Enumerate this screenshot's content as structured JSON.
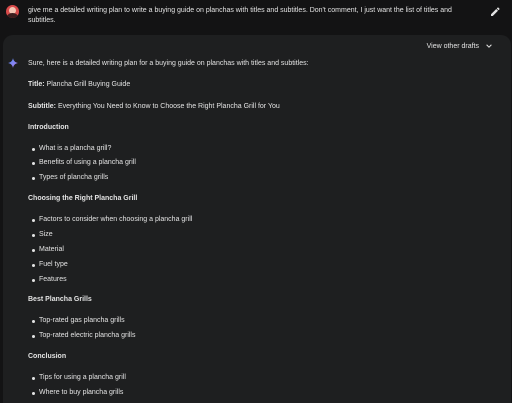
{
  "prompt": {
    "text": "give me a detailed writing plan to write a buying guide on planchas with titles and subtitles. Don't comment, I just want the list of titles and subtitles."
  },
  "response": {
    "drafts_label": "View other drafts",
    "intro": "Sure, here is a detailed writing plan for a buying guide on planchas with titles and subtitles:",
    "title_label": "Title:",
    "title_value": " Plancha Grill Buying Guide",
    "subtitle_label": "Subtitle:",
    "subtitle_value": " Everything You Need to Know to Choose the Right Plancha Grill for You",
    "sections": [
      {
        "heading": "Introduction",
        "items": [
          "What is a plancha grill?",
          "Benefits of using a plancha grill",
          "Types of plancha grills"
        ]
      },
      {
        "heading": "Choosing the Right Plancha Grill",
        "items": [
          "Factors to consider when choosing a plancha grill",
          "Size",
          "Material",
          "Fuel type",
          "Features"
        ]
      },
      {
        "heading": "Best Plancha Grills",
        "items": [
          "Top-rated gas plancha grills",
          "Top-rated electric plancha grills"
        ]
      },
      {
        "heading": "Conclusion",
        "items": [
          "Tips for using a plancha grill",
          "Where to buy plancha grills"
        ]
      }
    ]
  },
  "icons": {
    "edit": "pencil-icon",
    "drafts": "chevron-down-icon",
    "assistant": "sparkle-icon",
    "user": "user-avatar"
  }
}
